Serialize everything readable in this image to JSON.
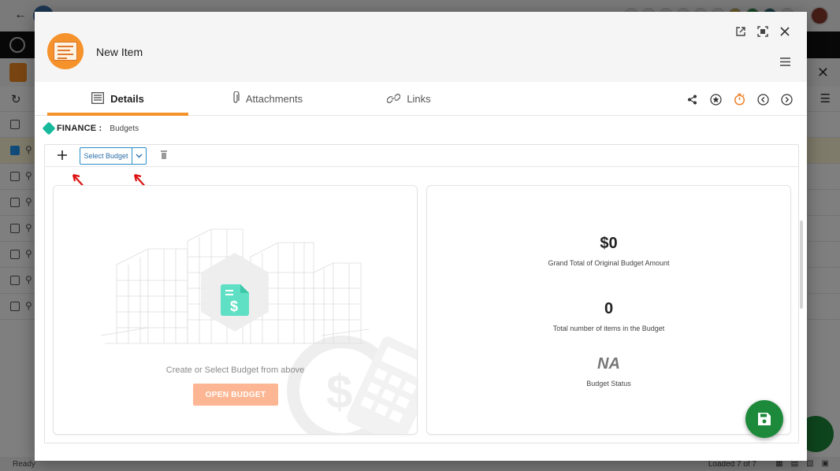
{
  "modal": {
    "title": "New Item"
  },
  "tabs": [
    {
      "label": "Details",
      "icon": "details-list-icon",
      "active": true
    },
    {
      "label": "Attachments",
      "icon": "paperclip-icon",
      "active": false
    },
    {
      "label": "Links",
      "icon": "link-icon",
      "active": false
    }
  ],
  "tab_actions": [
    "share-icon",
    "favorite-star-icon",
    "timer-icon",
    "previous-icon",
    "next-icon"
  ],
  "breadcrumb": {
    "module": "FINANCE :",
    "page": "Budgets"
  },
  "budget_toolbar": {
    "select_placeholder": "Select Budget"
  },
  "left_card": {
    "empty_text": "Create or Select Budget from above",
    "open_button": "OPEN BUDGET"
  },
  "stats": {
    "grand_total": {
      "value": "$0",
      "label": "Grand Total of Original Budget Amount"
    },
    "item_count": {
      "value": "0",
      "label": "Total number of items in the Budget"
    },
    "status": {
      "value": "NA",
      "label": "Budget Status"
    }
  },
  "background": {
    "status_left": "Ready",
    "status_right": "Loaded 7 of 7"
  },
  "colors": {
    "accent": "#f5922b",
    "primary": "#2b8ec9",
    "save_fab": "#1d8a3b",
    "finance_icon": "#16b99b",
    "open_button": "#fdb693"
  }
}
